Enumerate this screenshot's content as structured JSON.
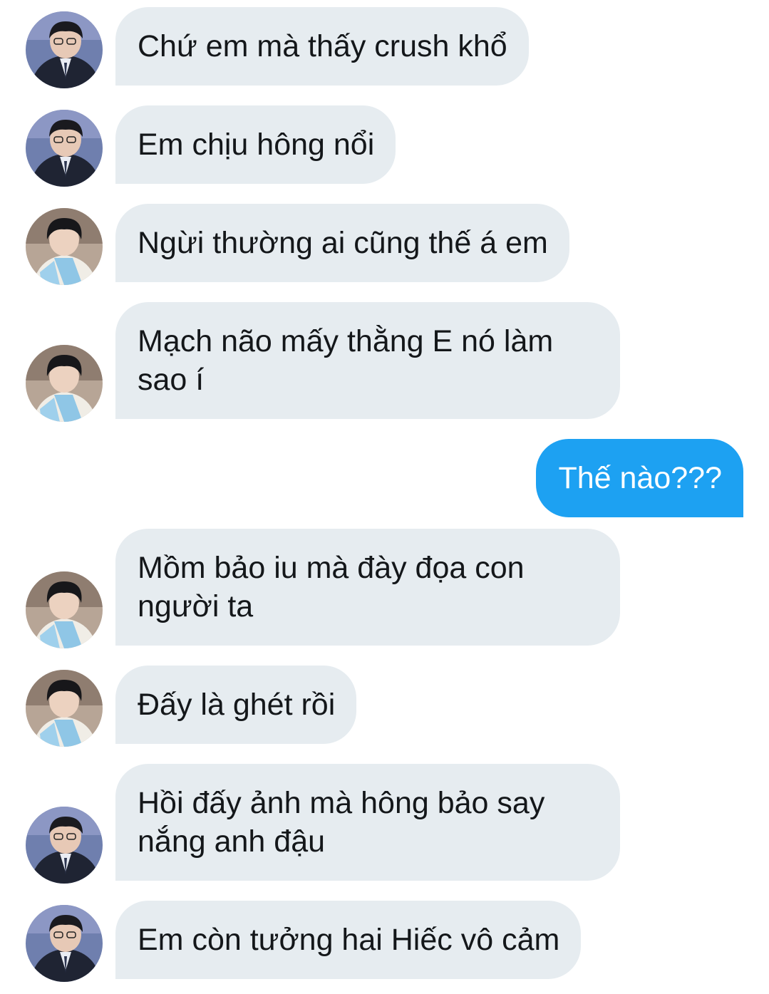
{
  "conversation": {
    "messages": [
      {
        "sender": "A",
        "text": "Chứ em mà thấy crush khổ"
      },
      {
        "sender": "A",
        "text": "Em chịu hông nổi"
      },
      {
        "sender": "B",
        "text": "Ngừi thường ai cũng thế á em"
      },
      {
        "sender": "B",
        "text": "Mạch não mấy thằng E nó làm sao í"
      },
      {
        "sender": "me",
        "text": "Thế nào???"
      },
      {
        "sender": "B",
        "text": "Mồm bảo iu mà đày đọa con người ta"
      },
      {
        "sender": "B",
        "text": "Đấy là ghét rồi"
      },
      {
        "sender": "A",
        "text": "Hồi đấy ảnh mà hông bảo say nắng anh đậu"
      },
      {
        "sender": "A",
        "text": "Em còn tưởng hai Hiếc vô cảm"
      }
    ]
  },
  "colors": {
    "incoming_bubble": "#e6ecf0",
    "outgoing_bubble": "#1da1f2",
    "incoming_text": "#14171a",
    "outgoing_text": "#ffffff"
  }
}
